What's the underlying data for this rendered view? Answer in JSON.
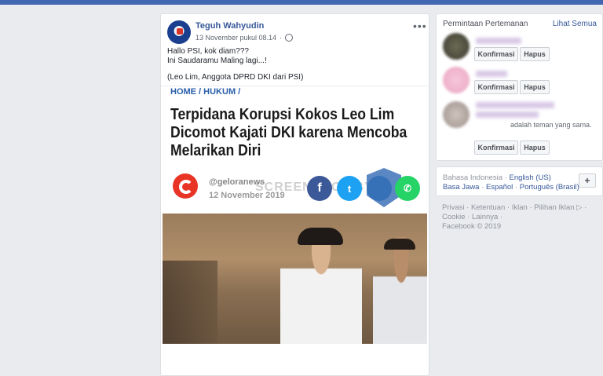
{
  "post": {
    "author": "Teguh Wahyudin",
    "timestamp": "13 November pukul 08.14",
    "privacy_icon": "globe-icon",
    "more": "•••",
    "text_lines": [
      "Hallo PSI, kok diam???",
      "Ini Saudaramu Maling lagi...!",
      "(Leo Lim, Anggota DPRD DKI dari PSI)"
    ]
  },
  "article": {
    "breadcrumb": "HOME / HUKUM /",
    "headline": "Terpidana Korupsi Kokos Leo Lim Dicomot Kajati DKI karena Mencoba Melarikan Diri",
    "site": "@geloranews",
    "date": "12 November 2019",
    "watermark": "SCREENSHOT BY",
    "share_icons": [
      "f",
      "t",
      "",
      "✆"
    ]
  },
  "friend_requests": {
    "title": "Permintaan Pertemanan",
    "see_all": "Lihat Semua",
    "confirm_label": "Konfirmasi",
    "delete_label": "Hapus",
    "mutual_text": "adalah teman yang sama."
  },
  "language": {
    "current": "Bahasa Indonesia",
    "links_row1": "English (US)",
    "links_row2": [
      "Basa Jawa",
      "Español",
      "Português (Brasil)"
    ],
    "add": "+"
  },
  "footer": {
    "links": [
      "Privasi",
      "Ketentuan",
      "Iklan",
      "Pilihan Iklan",
      "Cookie",
      "Lainnya"
    ],
    "copyright": "Facebook © 2019"
  }
}
